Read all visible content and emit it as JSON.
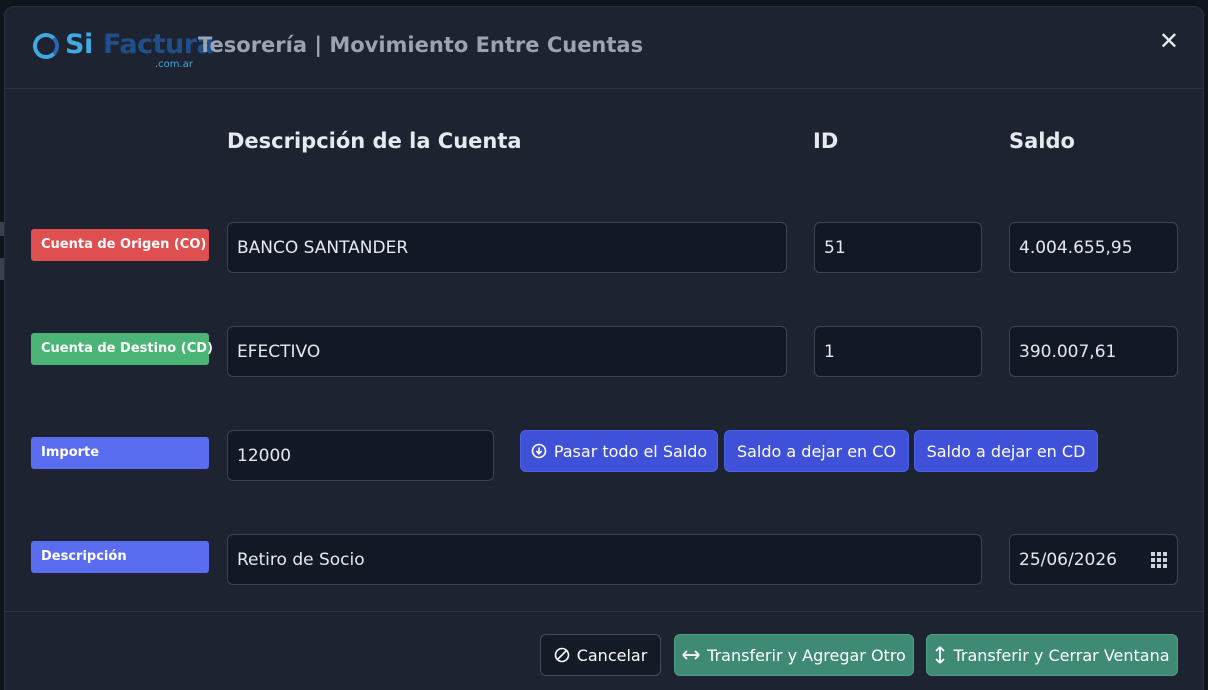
{
  "header": {
    "logo": {
      "si": "Si",
      "factura": "Factura",
      "domain": ".com.ar"
    },
    "title": "Tesorería | Movimiento Entre Cuentas",
    "close_icon": "close-icon"
  },
  "columns": {
    "description": "Descripción de la Cuenta",
    "id": "ID",
    "balance": "Saldo"
  },
  "origin": {
    "label": "Cuenta de Origen (CO)",
    "account": "BANCO SANTANDER",
    "id": "51",
    "balance": "4.004.655,95"
  },
  "destination": {
    "label": "Cuenta de Destino (CD)",
    "account": "EFECTIVO",
    "id": "1",
    "balance": "390.007,61"
  },
  "amount": {
    "label": "Importe",
    "value": "12000",
    "buttons": {
      "transfer_all": "Pasar todo el Saldo",
      "leave_in_co": "Saldo a dejar en CO",
      "leave_in_cd": "Saldo a dejar en CD"
    }
  },
  "description": {
    "label": "Descripción",
    "value": "Retiro de Socio",
    "date": "25/06/2026"
  },
  "footer": {
    "cancel": "Cancelar",
    "transfer_add": "Transferir y Agregar Otro",
    "transfer_close": "Transferir y Cerrar Ventana"
  },
  "colors": {
    "origin_label": "#df4f4f",
    "destination_label": "#4ab576",
    "neutral_label": "#5a6cf0",
    "primary_button": "#4051d9",
    "success_button": "#3f8a74"
  }
}
